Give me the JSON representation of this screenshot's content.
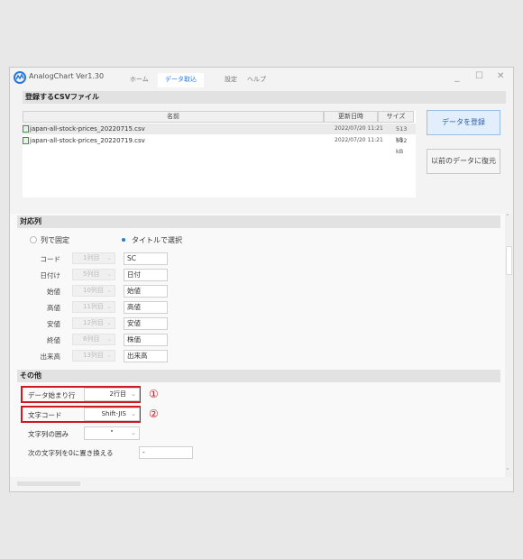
{
  "app": {
    "title": "AnalogChart Ver1.30"
  },
  "tabs": [
    {
      "label": "ホーム"
    },
    {
      "label": "データ取込"
    },
    {
      "label": "設定"
    },
    {
      "label": "ヘルプ"
    }
  ],
  "active_tab": 1,
  "window_controls": {
    "minimize": "_",
    "maximize": "☐",
    "close": "✕"
  },
  "csv_section": {
    "heading": "登録するCSVファイル",
    "columns": {
      "name": "名前",
      "modified": "更新日時",
      "size": "サイズ"
    },
    "files": [
      {
        "name": "japan-all-stock-prices_20220715.csv",
        "modified": "2022/07/20 11:21",
        "size": "513 kB",
        "selected": true
      },
      {
        "name": "japan-all-stock-prices_20220719.csv",
        "modified": "2022/07/20 11:21",
        "size": "512 kB",
        "selected": false
      }
    ],
    "register_button": "データを登録",
    "restore_button": "以前のデータに復元"
  },
  "mapping_section": {
    "heading": "対応列",
    "radio_fixed": "列で固定",
    "radio_title": "タイトルで選択",
    "selected_mode": "title",
    "fields": [
      {
        "label": "コード",
        "column": "1列目",
        "title": "SC"
      },
      {
        "label": "日付け",
        "column": "5列目",
        "title": "日付"
      },
      {
        "label": "始値",
        "column": "10列目",
        "title": "始値"
      },
      {
        "label": "高値",
        "column": "11列目",
        "title": "高値"
      },
      {
        "label": "安値",
        "column": "12列目",
        "title": "安値"
      },
      {
        "label": "終値",
        "column": "6列目",
        "title": "株価"
      },
      {
        "label": "出来高",
        "column": "13列目",
        "title": "出来高"
      }
    ]
  },
  "other_section": {
    "heading": "その他",
    "data_start_label": "データ始まり行",
    "data_start_value": "2行目",
    "encoding_label": "文字コード",
    "encoding_value": "Shift-JIS",
    "quote_label": "文字列の囲み",
    "quote_value": "\"",
    "replace_label": "次の文字列を0に置き換える",
    "replace_value": "-"
  },
  "annotations": {
    "callout_1": "①",
    "callout_2": "②",
    "highlight_color": "#d01920"
  },
  "colors": {
    "accent": "#2a78d8",
    "section_header": "#e2e2e2"
  },
  "icons": {
    "logo": "analogchart-logo-icon",
    "file": "csv-file-icon",
    "chevron": "chevron-down-icon"
  }
}
